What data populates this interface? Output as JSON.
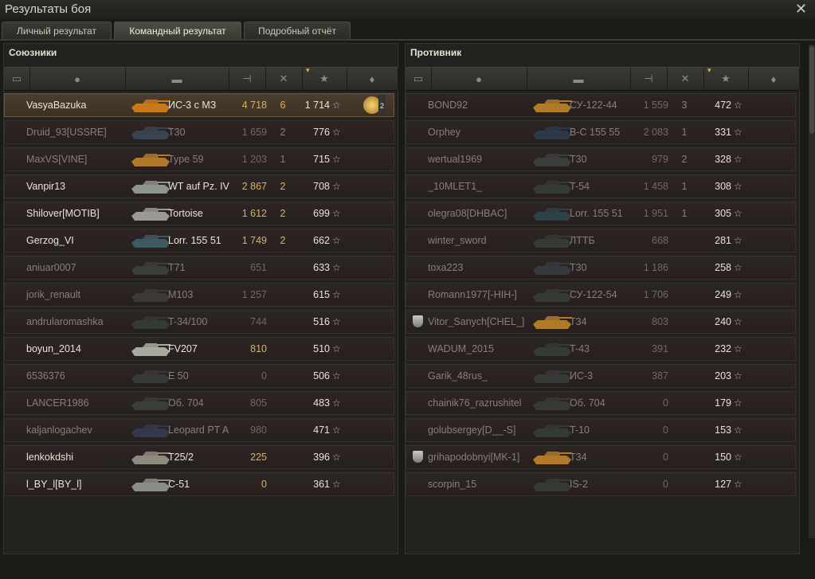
{
  "window": {
    "title": "Результаты боя",
    "close_glyph": "✕"
  },
  "tabs": [
    {
      "label": "Личный результат",
      "active": false
    },
    {
      "label": "Командный результат",
      "active": true
    },
    {
      "label": "Подробный отчёт",
      "active": false
    }
  ],
  "colors": {
    "accent_gold": "#d8b552",
    "row_red": "#2e2624",
    "player_highlight": "#4c3d2f"
  },
  "header_icons": [
    "clan-icon",
    "player-icon",
    "tank-icon",
    "damage-icon",
    "kills-icon",
    "xp-star-icon",
    "medal-icon"
  ],
  "star_glyph": "☆",
  "allies": {
    "title": "Союзники",
    "rows": [
      {
        "name": "VasyaBazuka",
        "vehicle": "ИС-3 с МЗ",
        "damage": "4 718",
        "kills": "6",
        "xp": "1 714",
        "alive": true,
        "me": true,
        "medal": "2",
        "tank_color": "#c7791c"
      },
      {
        "name": "Druid_93[USSRE]",
        "vehicle": "T30",
        "damage": "1 659",
        "kills": "2",
        "xp": "776",
        "alive": false,
        "tank_color": "#3a4450"
      },
      {
        "name": "MaxVS[VINE]",
        "vehicle": "Type 59",
        "damage": "1 203",
        "kills": "1",
        "xp": "715",
        "alive": false,
        "tank_color": "#b07a2a"
      },
      {
        "name": "Vanpir13",
        "vehicle": "WT auf Pz. IV",
        "damage": "2 867",
        "kills": "2",
        "xp": "708",
        "alive": true,
        "tank_color": "#8e9490"
      },
      {
        "name": "Shilover[MOTIB]",
        "vehicle": "Tortoise",
        "damage": "1 612",
        "kills": "2",
        "xp": "699",
        "alive": true,
        "tank_color": "#9a9a92"
      },
      {
        "name": "Gerzog_VI",
        "vehicle": "Lorr. 155 51",
        "damage": "1 749",
        "kills": "2",
        "xp": "662",
        "alive": true,
        "tank_color": "#3e5a60"
      },
      {
        "name": "aniuar0007",
        "vehicle": "T71",
        "damage": "651",
        "kills": "",
        "xp": "633",
        "alive": false,
        "tank_color": "#3a3e3a"
      },
      {
        "name": "jorik_renault",
        "vehicle": "M103",
        "damage": "1 257",
        "kills": "",
        "xp": "615",
        "alive": false,
        "tank_color": "#3c3a36"
      },
      {
        "name": "andrularomashka",
        "vehicle": "T-34/100",
        "damage": "744",
        "kills": "",
        "xp": "516",
        "alive": false,
        "tank_color": "#343a34"
      },
      {
        "name": "boyun_2014",
        "vehicle": "FV207",
        "damage": "810",
        "kills": "",
        "xp": "510",
        "alive": true,
        "tank_color": "#a8aaa2"
      },
      {
        "name": "6536376",
        "vehicle": "E 50",
        "damage": "0",
        "kills": "",
        "xp": "506",
        "alive": false,
        "tank_color": "#363a3c"
      },
      {
        "name": "LANCER1986",
        "vehicle": "Об. 704",
        "damage": "805",
        "kills": "",
        "xp": "483",
        "alive": false,
        "tank_color": "#3a3e36"
      },
      {
        "name": "kaljanlogachev",
        "vehicle": "Leopard PT A",
        "damage": "980",
        "kills": "",
        "xp": "471",
        "alive": false,
        "tank_color": "#34384a"
      },
      {
        "name": "lenkokdshi",
        "vehicle": "T25/2",
        "damage": "225",
        "kills": "",
        "xp": "396",
        "alive": true,
        "tank_color": "#8e8a80"
      },
      {
        "name": "l_BY_l[BY_l]",
        "vehicle": "С-51",
        "damage": "0",
        "kills": "",
        "xp": "361",
        "alive": true,
        "tank_color": "#8a8e84"
      }
    ]
  },
  "enemies": {
    "title": "Противник",
    "rows": [
      {
        "name": "BOND92",
        "vehicle": "СУ-122-44",
        "damage": "1 559",
        "kills": "3",
        "xp": "472",
        "alive": false,
        "tank_color": "#b07a2a"
      },
      {
        "name": "Orphey",
        "vehicle": "B-C 155 55",
        "damage": "2 083",
        "kills": "1",
        "xp": "331",
        "alive": false,
        "tank_color": "#2c3a48"
      },
      {
        "name": "wertual1969",
        "vehicle": "T30",
        "damage": "979",
        "kills": "2",
        "xp": "328",
        "alive": false,
        "tank_color": "#3a3e3a"
      },
      {
        "name": "_10MLET1_",
        "vehicle": "T-54",
        "damage": "1 458",
        "kills": "1",
        "xp": "308",
        "alive": false,
        "tank_color": "#343a34"
      },
      {
        "name": "olegra08[DHBAC]",
        "vehicle": "Lorr. 155 51",
        "damage": "1 951",
        "kills": "1",
        "xp": "305",
        "alive": false,
        "tank_color": "#2e4048"
      },
      {
        "name": "winter_sword",
        "vehicle": "ЛТТБ",
        "damage": "668",
        "kills": "",
        "xp": "281",
        "alive": false,
        "tank_color": "#363a36"
      },
      {
        "name": "toxa223",
        "vehicle": "T30",
        "damage": "1 186",
        "kills": "",
        "xp": "258",
        "alive": false,
        "tank_color": "#363a3c"
      },
      {
        "name": "Romann1977[-HIH-]",
        "vehicle": "СУ-122-54",
        "damage": "1 706",
        "kills": "",
        "xp": "249",
        "alive": false,
        "tank_color": "#363a36"
      },
      {
        "name": "Vitor_Sanych[CHEL_]",
        "vehicle": "T34",
        "damage": "803",
        "kills": "",
        "xp": "240",
        "alive": false,
        "clan": true,
        "tank_color": "#b07a2a"
      },
      {
        "name": "WADUM_2015",
        "vehicle": "T-43",
        "damage": "391",
        "kills": "",
        "xp": "232",
        "alive": false,
        "tank_color": "#343a34"
      },
      {
        "name": "Garik_48rus_",
        "vehicle": "ИС-3",
        "damage": "387",
        "kills": "",
        "xp": "203",
        "alive": false,
        "tank_color": "#363a36"
      },
      {
        "name": "chainik76_razrushitel",
        "vehicle": "Об. 704",
        "damage": "0",
        "kills": "",
        "xp": "179",
        "alive": false,
        "tank_color": "#363a36"
      },
      {
        "name": "golubsergey[D__-S]",
        "vehicle": "T-10",
        "damage": "0",
        "kills": "",
        "xp": "153",
        "alive": false,
        "tank_color": "#343a34"
      },
      {
        "name": "grihapodobnyi[MK-1]",
        "vehicle": "T34",
        "damage": "0",
        "kills": "",
        "xp": "150",
        "alive": false,
        "clan": true,
        "tank_color": "#b07a2a"
      },
      {
        "name": "scorpin_15",
        "vehicle": "IS-2",
        "damage": "0",
        "kills": "",
        "xp": "127",
        "alive": false,
        "tank_color": "#363a36"
      }
    ]
  }
}
